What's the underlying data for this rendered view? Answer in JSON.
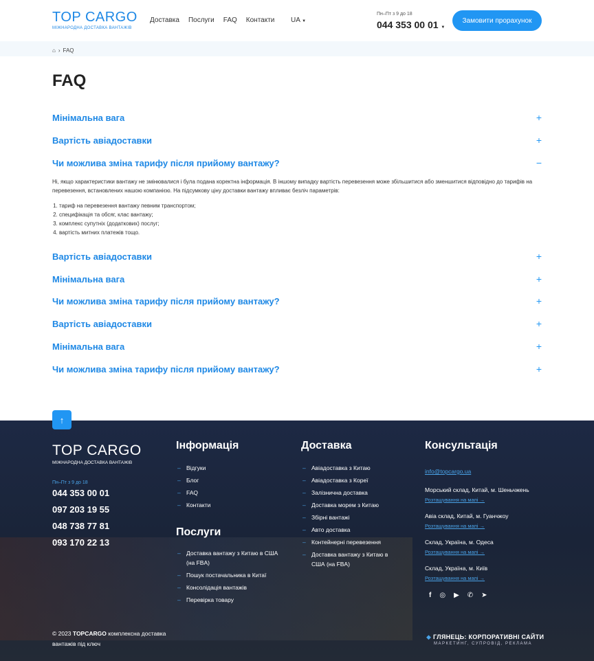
{
  "header": {
    "logo_main": "TOP CARGO",
    "logo_sub": "МІЖНАРОДНА ДОСТАВКА ВАНТАЖІВ",
    "nav": [
      "Доставка",
      "Послуги",
      "FAQ",
      "Контакти"
    ],
    "lang": "UA",
    "hours": "Пн–Пт з 9 до 18",
    "phone": "044 353 00 01",
    "cta": "Замовити прорахунок"
  },
  "breadcrumb": {
    "current": "FAQ"
  },
  "page_title": "FAQ",
  "faq": [
    {
      "q": "Мінімальна вага",
      "open": false
    },
    {
      "q": "Вартість авіадоставки",
      "open": false
    },
    {
      "q": "Чи можлива зміна тарифу після прийому вантажу?",
      "open": true
    },
    {
      "q": "Вартість авіадоставки",
      "open": false
    },
    {
      "q": "Мінімальна вага",
      "open": false
    },
    {
      "q": "Чи можлива зміна тарифу після прийому вантажу?",
      "open": false
    },
    {
      "q": "Вартість авіадоставки",
      "open": false
    },
    {
      "q": "Мінімальна вага",
      "open": false
    },
    {
      "q": "Чи можлива зміна тарифу після прийому вантажу?",
      "open": false
    }
  ],
  "answer": {
    "text": "Ні, якщо характеристики вантажу не змінювалися і була подана коректна інформація. В іншому випадку вартість перевезення може збільшитися або зменшитися відповідно до тарифів на перевезення, встановлених нашою компанією. На підсумкову ціну доставки вантажу впливає безліч параметрів:",
    "list": [
      "тариф на перевезення вантажу певним транспортом;",
      "специфікація та обсяг, клас вантажу;",
      "комплекс супутніх (додаткових) послуг;",
      "вартість митних платежів тощо."
    ]
  },
  "footer": {
    "hours": "Пн–Пт з 9 до 18",
    "phones": [
      "044 353 00 01",
      "097 203 19 55",
      "048 738 77 81",
      "093 170 22 13"
    ],
    "copyright_prefix": "© 2023 ",
    "copyright_brand": "TOPCARGO",
    "copyright_rest": " комплексна доставка вантажів під ключ",
    "info_title": "Інформація",
    "info": [
      "Відгуки",
      "Блог",
      "FAQ",
      "Контакти"
    ],
    "services_title": "Послуги",
    "services": [
      "Доставка вантажу з Китаю в США (на FBA)",
      "Пошук постачальника в Китаї",
      "Консолідація вантажів",
      "Перевірка товару"
    ],
    "delivery_title": "Доставка",
    "delivery": [
      "Авіадоставка з Китаю",
      "Авіадоставка з Кореї",
      "Залізнична доставка",
      "Доставка морем з Китаю",
      "Збірні вантажі",
      "Авто доставка",
      "Контейнерні перевезення",
      "Доставка вантажу з Китаю в США (на FBA)"
    ],
    "consult_title": "Консультація",
    "email": "info@topcargo.ua",
    "addresses": [
      "Морський склад, Китай, м. Шеньчжень",
      "Авіа склад, Китай, м. Гуанчжоу",
      "Склад, Україна, м. Одеса",
      "Склад, Україна, м. Київ"
    ],
    "map_link": "Розташування на мапі",
    "social": [
      "facebook-icon",
      "instagram-icon",
      "youtube-icon",
      "viber-icon",
      "telegram-icon"
    ],
    "dev_title": "ГЛЯНЕЦЬ: КОРПОРАТИВНІ САЙТИ",
    "dev_sub": "МАРКЕТИНГ, СУПРОВІД, РЕКЛАМА"
  },
  "colors": {
    "accent": "#2196f3",
    "title_blue": "#1e88e5",
    "footer_bg": "#1a2438"
  }
}
